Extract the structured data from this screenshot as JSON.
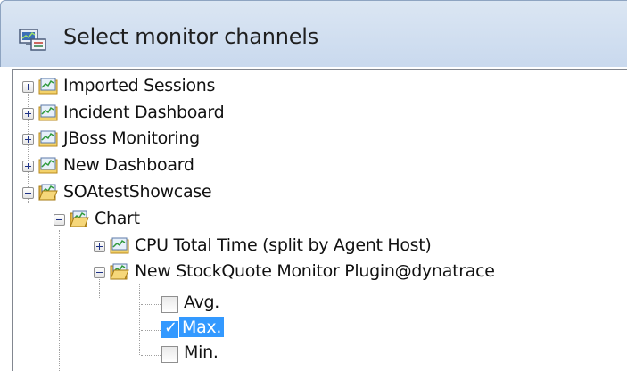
{
  "dialog": {
    "title": "Select monitor channels"
  },
  "tree": {
    "items": [
      {
        "label": "Imported Sessions",
        "state": "collapsed",
        "icon": "dashboard-icon"
      },
      {
        "label": "Incident Dashboard",
        "state": "collapsed",
        "icon": "dashboard-icon"
      },
      {
        "label": "JBoss Monitoring",
        "state": "collapsed",
        "icon": "dashboard-icon"
      },
      {
        "label": "New Dashboard",
        "state": "collapsed",
        "icon": "dashboard-icon"
      },
      {
        "label": "SOAtestShowcase",
        "state": "expanded",
        "icon": "open-dashboard-icon"
      },
      {
        "label": "Chart",
        "state": "expanded",
        "icon": "open-chart-icon"
      },
      {
        "label": "CPU Total Time (split by Agent Host)",
        "state": "collapsed",
        "icon": "chart-icon"
      },
      {
        "label": "New StockQuote Monitor Plugin@dynatrace",
        "state": "expanded",
        "icon": "open-chart-icon"
      }
    ],
    "channels": [
      {
        "label": "Avg.",
        "checked": false,
        "selected": false
      },
      {
        "label": "Max.",
        "checked": true,
        "selected": true,
        "check_mark": "✓"
      },
      {
        "label": "Min.",
        "checked": false,
        "selected": false
      }
    ]
  },
  "colors": {
    "selection": "#3399ff",
    "titlebar": "#d4e1f2"
  }
}
